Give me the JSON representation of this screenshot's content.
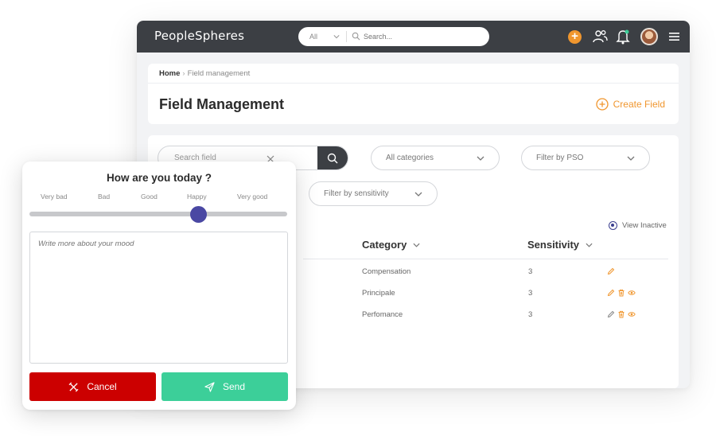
{
  "app": {
    "logo": "PeopleSpheres",
    "search": {
      "scope": "All",
      "placeholder": "Search..."
    }
  },
  "breadcrumb": {
    "home": "Home",
    "current": "Field management"
  },
  "page": {
    "title": "Field Management",
    "create_label": "Create Field"
  },
  "filters": {
    "search_placeholder": "Search field",
    "categories": "All categories",
    "pso": "Filter by PSO",
    "sensitivity": "Filter by sensitivity"
  },
  "view_inactive": "View Inactive",
  "table": {
    "columns": {
      "category": "Category",
      "sensitivity": "Sensitivity"
    },
    "rows": [
      {
        "category": "Compensation",
        "sensitivity": "3",
        "actions": [
          "edit"
        ]
      },
      {
        "category": "Principale",
        "sensitivity": "3",
        "actions": [
          "edit",
          "delete",
          "view"
        ]
      },
      {
        "category": "Perfomance",
        "sensitivity": "3",
        "actions": [
          "edit",
          "delete",
          "view"
        ]
      }
    ]
  },
  "mood": {
    "title": "How are you today ?",
    "scale": [
      "Very bad",
      "Bad",
      "Good",
      "Happy",
      "Very good"
    ],
    "selected": "Happy",
    "placeholder": "Write more about your mood",
    "cancel_label": "Cancel",
    "send_label": "Send"
  },
  "colors": {
    "accent": "#f0962e",
    "topbar": "#3c3f44",
    "slider_thumb": "#4a48a3",
    "cancel": "#cc0000",
    "send": "#3ccf99"
  }
}
